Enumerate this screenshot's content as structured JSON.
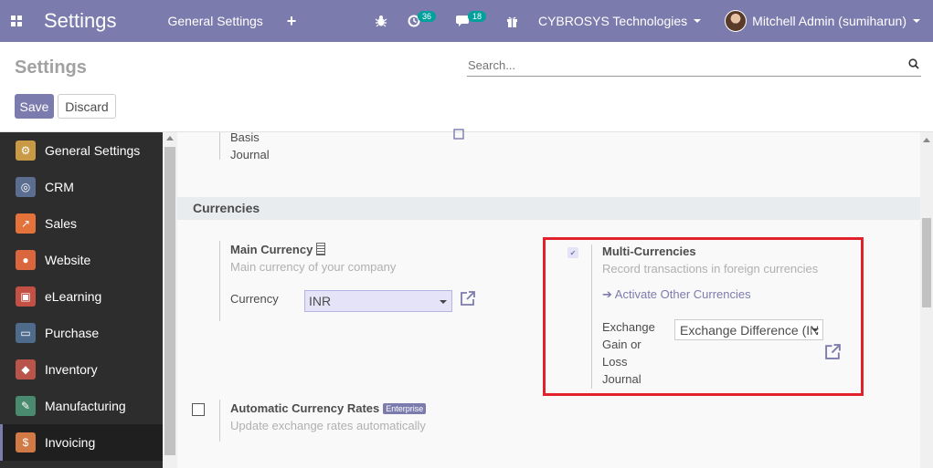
{
  "navbar": {
    "brand": "Settings",
    "menu_general": "General Settings",
    "plus": "+",
    "activity_count": "36",
    "message_count": "18",
    "company": "CYBROSYS Technologies",
    "user": "Mitchell Admin (sumiharun)"
  },
  "control": {
    "title": "Settings",
    "search_placeholder": "Search...",
    "save_label": "Save",
    "discard_label": "Discard"
  },
  "sidebar": {
    "items": [
      {
        "label": "General Settings",
        "icon": "gear-icon",
        "color": "#c89a46"
      },
      {
        "label": "CRM",
        "icon": "handshake-icon",
        "color": "#5b6e8f"
      },
      {
        "label": "Sales",
        "icon": "chart-icon",
        "color": "#e4733b"
      },
      {
        "label": "Website",
        "icon": "globe-icon",
        "color": "#d9663c"
      },
      {
        "label": "eLearning",
        "icon": "elearning-icon",
        "color": "#c25045"
      },
      {
        "label": "Purchase",
        "icon": "card-icon",
        "color": "#4f6b8c"
      },
      {
        "label": "Inventory",
        "icon": "box-icon",
        "color": "#b8544a"
      },
      {
        "label": "Manufacturing",
        "icon": "wrench-icon",
        "color": "#4a8a6f"
      },
      {
        "label": "Invoicing",
        "icon": "invoice-icon",
        "color": "#d27a45"
      }
    ]
  },
  "content": {
    "prev_label_1": "Basis",
    "prev_label_2": "Journal",
    "section_title": "Currencies",
    "main_currency": {
      "title": "Main Currency",
      "description": "Main currency of your company",
      "field_label": "Currency",
      "value": "INR"
    },
    "multi_currencies": {
      "title": "Multi-Currencies",
      "description": "Record transactions in foreign currencies",
      "link": "Activate Other Currencies",
      "journal_label": "Exchange Gain or Loss Journal",
      "journal_value": "Exchange Difference (IN"
    },
    "auto_rates": {
      "title": "Automatic Currency Rates",
      "badge": "Enterprise",
      "description": "Update exchange rates automatically"
    }
  },
  "colors": {
    "brand": "#7c7bad",
    "highlight": "#e1212c",
    "badge": "#00a09d"
  }
}
